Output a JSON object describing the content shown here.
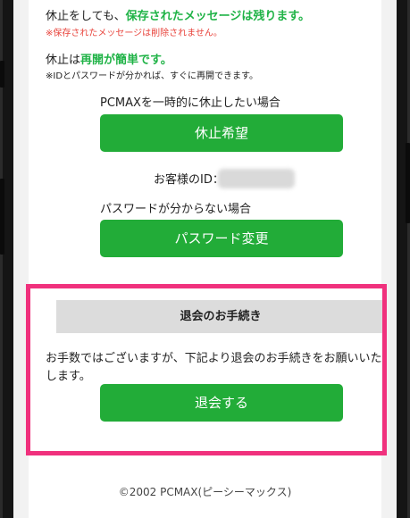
{
  "pause_section": {
    "line1_prefix": "休止をしても、",
    "line1_highlight": "保存されたメッセージは残ります。",
    "note1": "※保存されたメッセージは削除されません。",
    "line2_prefix": "休止は",
    "line2_highlight": "再開が簡単です。",
    "note2": "※IDとパスワードが分かれば、すぐに再開できます。",
    "pause_label": "PCMAXを一時的に休止したい場合",
    "pause_button": "休止希望",
    "customer_id_label": "お客様のID：",
    "password_label": "パスワードが分からない場合",
    "password_button": "パスワード変更"
  },
  "withdraw_section": {
    "heading": "退会のお手続き",
    "text": "お手数ではございますが、下記より退会のお手続きをお願いいたします。",
    "button": "退会する"
  },
  "footer": {
    "copyright": "©2002 PCMAX(ピーシーマックス)"
  },
  "colors": {
    "green": "#22ac38",
    "highlight_green": "#20b347",
    "red_note": "#e8423a",
    "pink_border": "#f0317d"
  }
}
